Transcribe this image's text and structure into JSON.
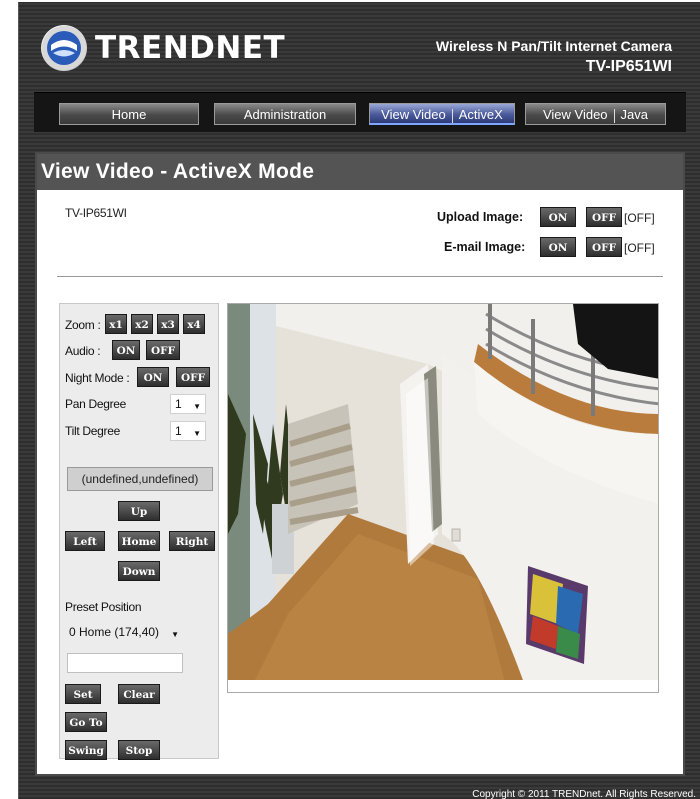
{
  "header": {
    "logo_text": "TRENDNET",
    "product_name": "Wireless N Pan/Tilt Internet Camera",
    "product_model": "TV-IP651WI"
  },
  "nav": {
    "home": "Home",
    "administration": "Administration",
    "view_video_activex_a": "View Video",
    "view_video_activex_b": "ActiveX",
    "view_video_java_a": "View Video",
    "view_video_java_b": "Java"
  },
  "panel": {
    "title": "View Video - ActiveX Mode",
    "device_name": "TV-IP651WI",
    "upload_label": "Upload Image:",
    "email_label": "E-mail Image:",
    "on": "ON",
    "off": "OFF",
    "upload_state": "[OFF]",
    "email_state": "[OFF]"
  },
  "controls": {
    "zoom_label": "Zoom :",
    "zoom_options": [
      "x1",
      "x2",
      "x3",
      "x4"
    ],
    "audio_label": "Audio :",
    "night_mode_label": "Night Mode :",
    "on": "ON",
    "off": "OFF",
    "pan_label": "Pan Degree",
    "pan_value": "1",
    "tilt_label": "Tilt Degree",
    "tilt_value": "1",
    "coords": "(undefined,undefined)",
    "up": "Up",
    "left": "Left",
    "home": "Home",
    "right": "Right",
    "down": "Down",
    "preset_label": "Preset Position",
    "preset_value": "0 Home (174,40)",
    "set": "Set",
    "clear": "Clear",
    "goto": "Go To",
    "swing": "Swing",
    "stop": "Stop"
  },
  "footer": {
    "copyright": "Copyright © 2011 TRENDnet. All Rights Reserved."
  },
  "colors": {
    "frame_dark": "#333333",
    "panel_title_bg": "#545454",
    "active_tab": "#4a5a9a"
  }
}
